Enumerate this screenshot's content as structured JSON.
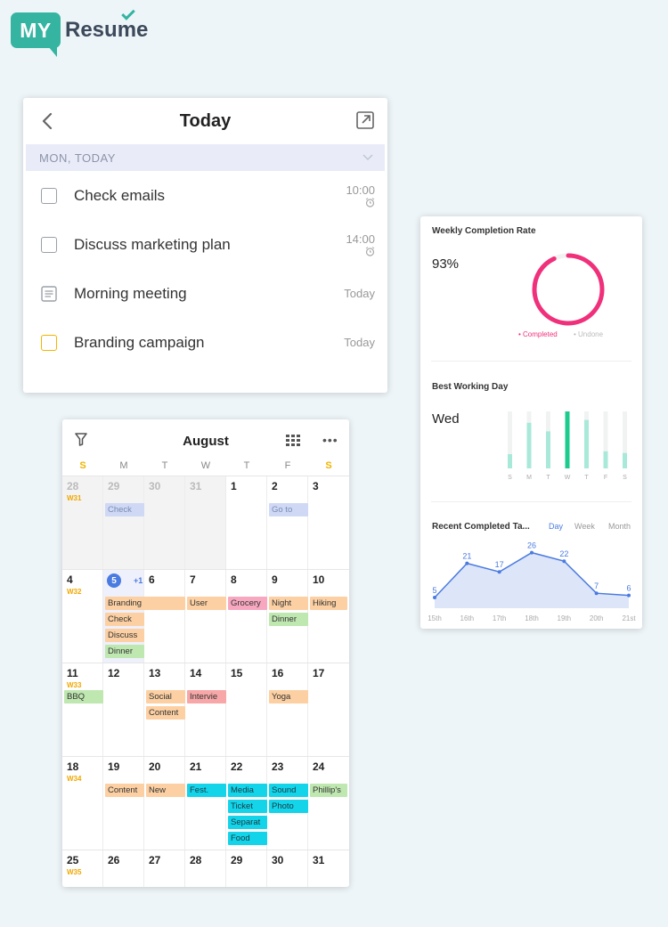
{
  "logo": {
    "badge": "MY",
    "text": "Resume"
  },
  "today_card": {
    "title": "Today",
    "section": "MON, TODAY",
    "tasks": [
      {
        "label": "Check emails",
        "time": "10:00",
        "icon": "checkbox-icon",
        "alarm": true
      },
      {
        "label": "Discuss marketing plan",
        "time": "14:00",
        "icon": "checkbox-icon",
        "alarm": true
      },
      {
        "label": "Morning meeting",
        "time": "Today",
        "icon": "note-icon"
      },
      {
        "label": "Branding campaign",
        "time": "Today",
        "icon": "checkbox-icon"
      }
    ]
  },
  "calendar": {
    "title": "August",
    "weekdays": [
      "S",
      "M",
      "T",
      "W",
      "T",
      "F",
      "S"
    ],
    "weeks": [
      {
        "label": "W31",
        "days": [
          "28",
          "29",
          "30",
          "31",
          "1",
          "2",
          "3"
        ]
      },
      {
        "label": "W32",
        "days": [
          "4",
          "5",
          "6",
          "7",
          "8",
          "9",
          "10"
        ]
      },
      {
        "label": "W33",
        "days": [
          "11",
          "12",
          "13",
          "14",
          "15",
          "16",
          "17"
        ]
      },
      {
        "label": "W34",
        "days": [
          "18",
          "19",
          "20",
          "21",
          "22",
          "23",
          "24"
        ]
      },
      {
        "label": "W35",
        "days": [
          "25",
          "26",
          "27",
          "28",
          "29",
          "30",
          "31"
        ]
      }
    ],
    "today_more": "+1",
    "events": {
      "check_blue": "Check",
      "goto": "Go to",
      "branding": "Branding",
      "check": "Check",
      "discuss": "Discuss",
      "dinner1": "Dinner",
      "user": "User",
      "grocery": "Grocery",
      "night": "Night",
      "dinner2": "Dinner",
      "hiking": "Hiking",
      "bbq": "BBQ",
      "social": "Social",
      "content1": "Content",
      "intervie": "Intervie",
      "yoga": "Yoga",
      "content2": "Content",
      "new": "New",
      "fest": "Fest.",
      "media": "Media",
      "ticket": "Ticket",
      "separat": "Separat",
      "food": "Food",
      "sound": "Sound",
      "photo": "Photo",
      "phillips": "Phillip's"
    }
  },
  "stats": {
    "weekly": {
      "title": "Weekly Completion Rate",
      "value": "93%",
      "completed_label": "Completed",
      "undone_label": "Undone",
      "rate": 0.93,
      "completed_color": "#f0307a"
    },
    "best_day": {
      "title": "Best Working Day",
      "value": "Wed",
      "days": [
        "S",
        "M",
        "T",
        "W",
        "T",
        "F",
        "S"
      ],
      "levels": [
        0.25,
        0.8,
        0.65,
        1.0,
        0.85,
        0.3,
        0.27
      ]
    },
    "recent": {
      "title": "Recent Completed Ta...",
      "tabs": [
        "Day",
        "Week",
        "Month"
      ],
      "active_tab": "Day"
    }
  },
  "chart_data": {
    "type": "area",
    "categories": [
      "15th",
      "16th",
      "17th",
      "18th",
      "19th",
      "20th",
      "21st"
    ],
    "values": [
      5,
      21,
      17,
      26,
      22,
      7,
      6
    ],
    "ylim": [
      0,
      30
    ],
    "color": "#4a7be0"
  }
}
